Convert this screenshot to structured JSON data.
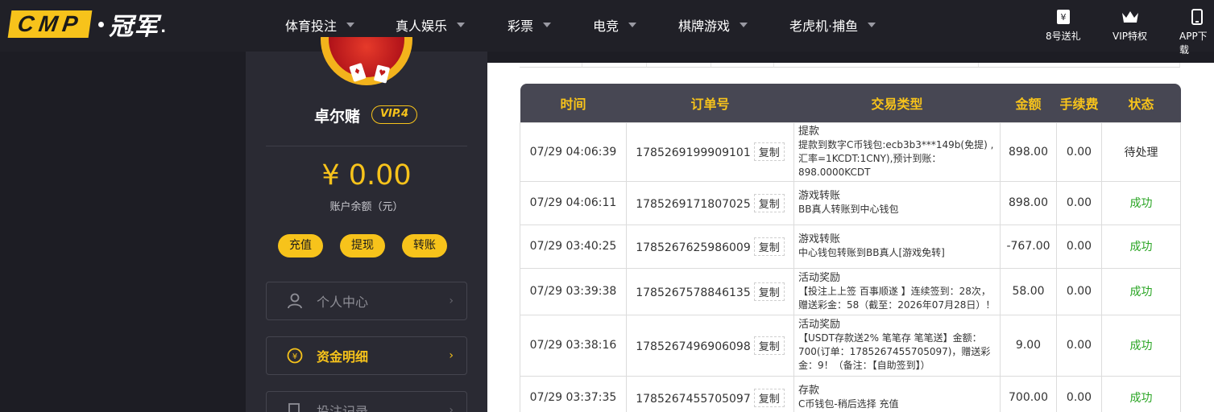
{
  "logo": {
    "cmp": "CMP",
    "cn": "冠军",
    "tail": "."
  },
  "nav": [
    {
      "label": "体育投注"
    },
    {
      "label": "真人娱乐"
    },
    {
      "label": "彩票"
    },
    {
      "label": "电竞"
    },
    {
      "label": "棋牌游戏"
    },
    {
      "label": "老虎机·捕鱼"
    }
  ],
  "nav_right": [
    {
      "label": "8号送礼",
      "icon": "gift-icon"
    },
    {
      "label": "VIP特权",
      "icon": "crown-icon"
    },
    {
      "label": "APP下载",
      "icon": "phone-icon"
    }
  ],
  "profile": {
    "username": "卓尔赌",
    "vip": "VIP.4",
    "balance": "¥ 0.00",
    "balance_label": "账户余额（元）",
    "actions": [
      "充值",
      "提现",
      "转账"
    ]
  },
  "menu": [
    {
      "label": "个人中心",
      "icon": "user-icon"
    },
    {
      "label": "资金明细",
      "icon": "yen-coin-icon"
    },
    {
      "label": "投注记录",
      "icon": "bet-record-icon"
    }
  ],
  "table": {
    "headers": [
      "时间",
      "订单号",
      "交易类型",
      "金额",
      "手续费",
      "状态"
    ],
    "copy_label": "复制",
    "rows": [
      {
        "time": "07/29 04:06:39",
        "order": "1785269199909101",
        "type": "提款",
        "detail": "提款到数字C币钱包:ecb3b3***149b(免提) ,汇率=1KCDT:1CNY),预计到账：898.0000KCDT",
        "amount": "898.00",
        "fee": "0.00",
        "status": "待处理"
      },
      {
        "time": "07/29 04:06:11",
        "order": "1785269171807025",
        "type": "游戏转账",
        "detail": "BB真人转账到中心钱包",
        "amount": "898.00",
        "fee": "0.00",
        "status": "成功"
      },
      {
        "time": "07/29 03:40:25",
        "order": "1785267625986009",
        "type": "游戏转账",
        "detail": "中心钱包转账到BB真人[游戏免转]",
        "amount": "-767.00",
        "fee": "0.00",
        "status": "成功"
      },
      {
        "time": "07/29 03:39:38",
        "order": "1785267578846135",
        "type": "活动奖励",
        "detail": "【投注上上签 百事顺遂 】连续签到：28次，赠送彩金：58（截至：2026年07月28日）！",
        "amount": "58.00",
        "fee": "0.00",
        "status": "成功"
      },
      {
        "time": "07/29 03:38:16",
        "order": "1785267496906098",
        "type": "活动奖励",
        "detail": "【USDT存款送2% 笔笔存 笔笔送】金额：700(订单：1785267455705097)，赠送彩金：9！（备注：【自助签到】）",
        "amount": "9.00",
        "fee": "0.00",
        "status": "成功"
      },
      {
        "time": "07/29 03:37:35",
        "order": "1785267455705097",
        "type": "存款",
        "detail": "C币钱包-稍后选择 充值",
        "amount": "700.00",
        "fee": "0.00",
        "status": "成功"
      }
    ]
  },
  "colors": {
    "accent": "#f7c31b",
    "success": "#2aa524",
    "header_bg": "#474753"
  }
}
